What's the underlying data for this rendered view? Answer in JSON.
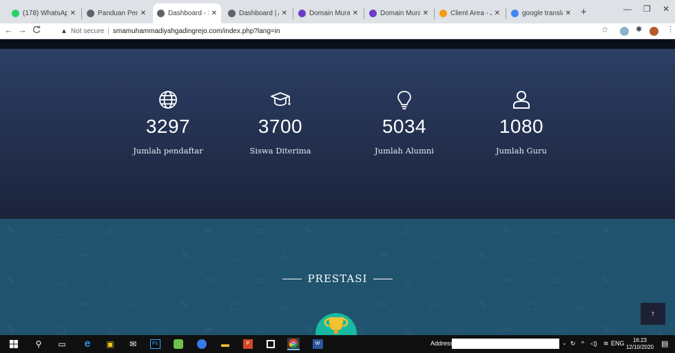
{
  "browser": {
    "tabs": [
      {
        "title": "(178) WhatsAp",
        "fav_color": "#25d366",
        "fav_icon": "whatsapp-icon",
        "active": false
      },
      {
        "title": "Panduan Peng",
        "fav_color": "#5f6368",
        "fav_icon": "globe-icon",
        "active": false
      },
      {
        "title": "Dashboard - S",
        "fav_color": "#5f6368",
        "fav_icon": "globe-icon",
        "active": true
      },
      {
        "title": "Dashboard | A",
        "fav_color": "#5f6368",
        "fav_icon": "globe-icon",
        "active": false
      },
      {
        "title": "Domain Mura",
        "fav_color": "#6d3ac9",
        "fav_icon": "niagahoster-icon",
        "active": false
      },
      {
        "title": "Domain Mura",
        "fav_color": "#6d3ac9",
        "fav_icon": "niagahoster-icon",
        "active": false
      },
      {
        "title": "Client Area - J",
        "fav_color": "#f39c12",
        "fav_icon": "jagoan-icon",
        "active": false
      },
      {
        "title": "google transla",
        "fav_color": "#4285f4",
        "fav_icon": "google-icon",
        "active": false
      }
    ],
    "security_label": "Not secure",
    "url": "smamuhammadiyahgadingrejo.com/index.php?lang=in"
  },
  "stats": [
    {
      "icon": "globe-icon",
      "value": "3297",
      "label": "Jumlah pendaftar"
    },
    {
      "icon": "graduation-cap-icon",
      "value": "3700",
      "label": "Siswa Diterima"
    },
    {
      "icon": "lightbulb-icon",
      "value": "5034",
      "label": "Jumlah Alumni"
    },
    {
      "icon": "user-icon",
      "value": "1080",
      "label": "Jumlah Guru"
    }
  ],
  "prestasi": {
    "title": "PRESTASI"
  },
  "taskbar": {
    "address_label": "Address",
    "language": "ENG",
    "time": "16:23",
    "date": "12/10/2020"
  },
  "colors": {
    "stats_bg": "#253252",
    "prestasi_bg": "#1f536e",
    "trophy_circle": "#17b9a0"
  }
}
